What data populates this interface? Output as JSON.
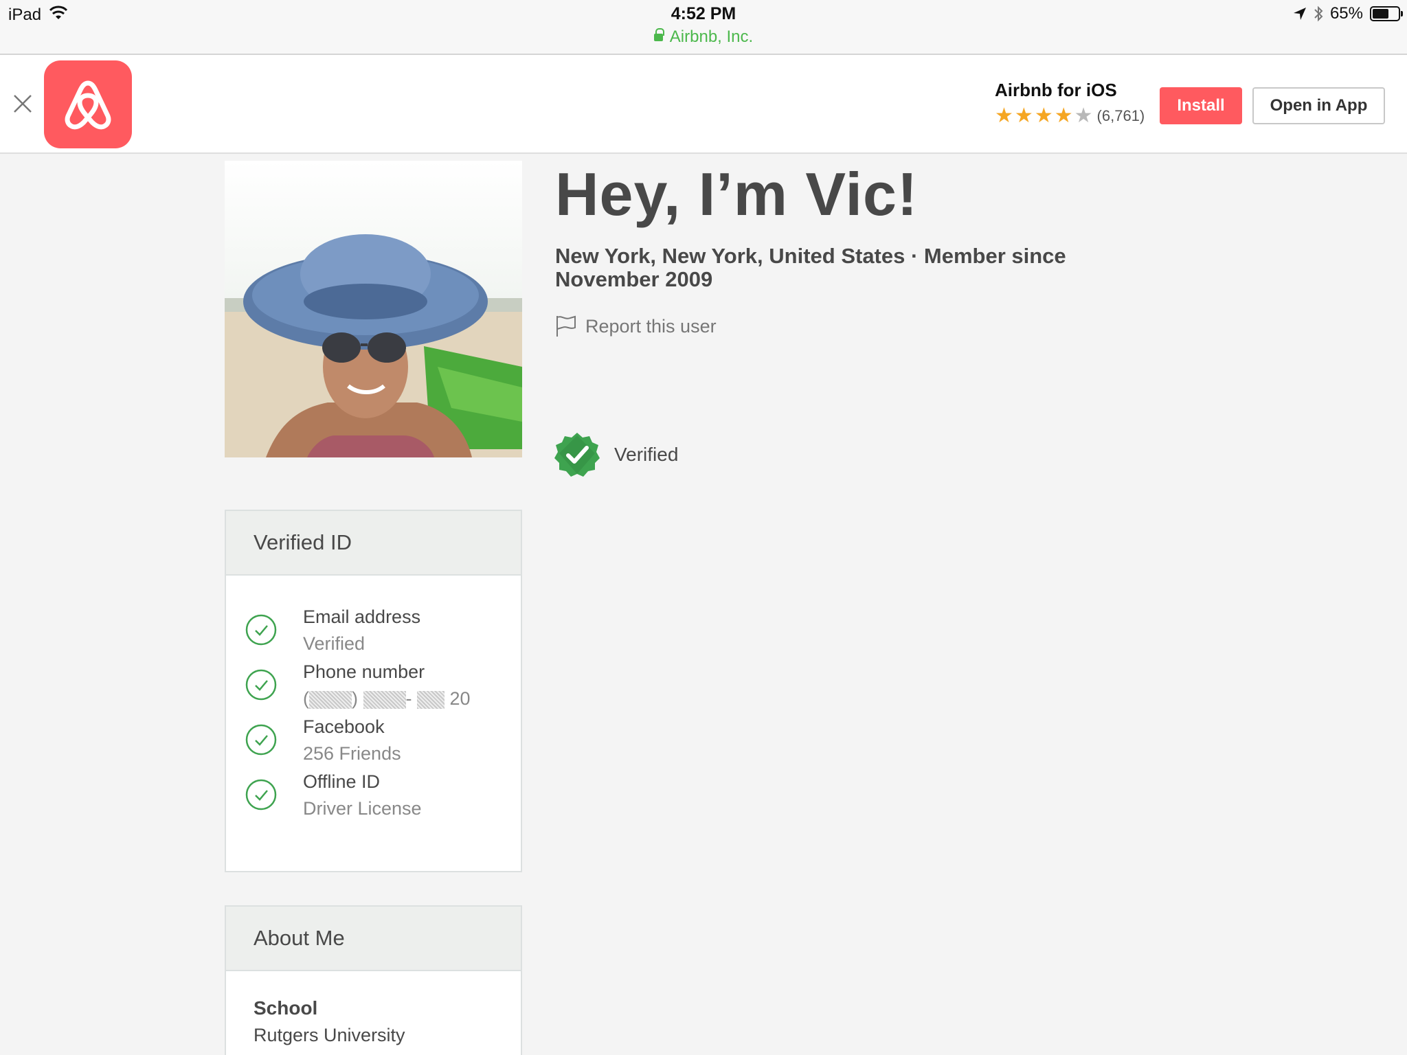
{
  "status_bar": {
    "device": "iPad",
    "time": "4:52 PM",
    "site": "Airbnb, Inc.",
    "battery": "65%",
    "battery_level": 0.65
  },
  "banner": {
    "app_name": "Airbnb for iOS",
    "rating_stars": 4,
    "rating_count": "(6,761)",
    "install_label": "Install",
    "open_label": "Open in App",
    "brand_color": "#ff5a5f"
  },
  "profile": {
    "greeting": "Hey, I’m Vic!",
    "location_line": "New York, New York, United States · Member since November 2009",
    "report_label": "Report this user",
    "verified_label": "Verified"
  },
  "verified_id": {
    "heading": "Verified ID",
    "items": [
      {
        "title": "Email address",
        "detail": "Verified",
        "icon": "check-circle-icon"
      },
      {
        "title": "Phone number",
        "detail_suffix": "20",
        "icon": "check-circle-icon"
      },
      {
        "title": "Facebook",
        "detail": "256 Friends",
        "icon": "check-circle-icon"
      },
      {
        "title": "Offline ID",
        "detail": "Driver License",
        "icon": "check-circle-icon"
      }
    ]
  },
  "about": {
    "heading": "About Me",
    "school_label": "School",
    "school_value": "Rutgers University"
  },
  "colors": {
    "accent": "#ff5a5f",
    "verified_green": "#3ea34f",
    "url_green": "#4cb84c",
    "star_gold": "#f5a623"
  }
}
